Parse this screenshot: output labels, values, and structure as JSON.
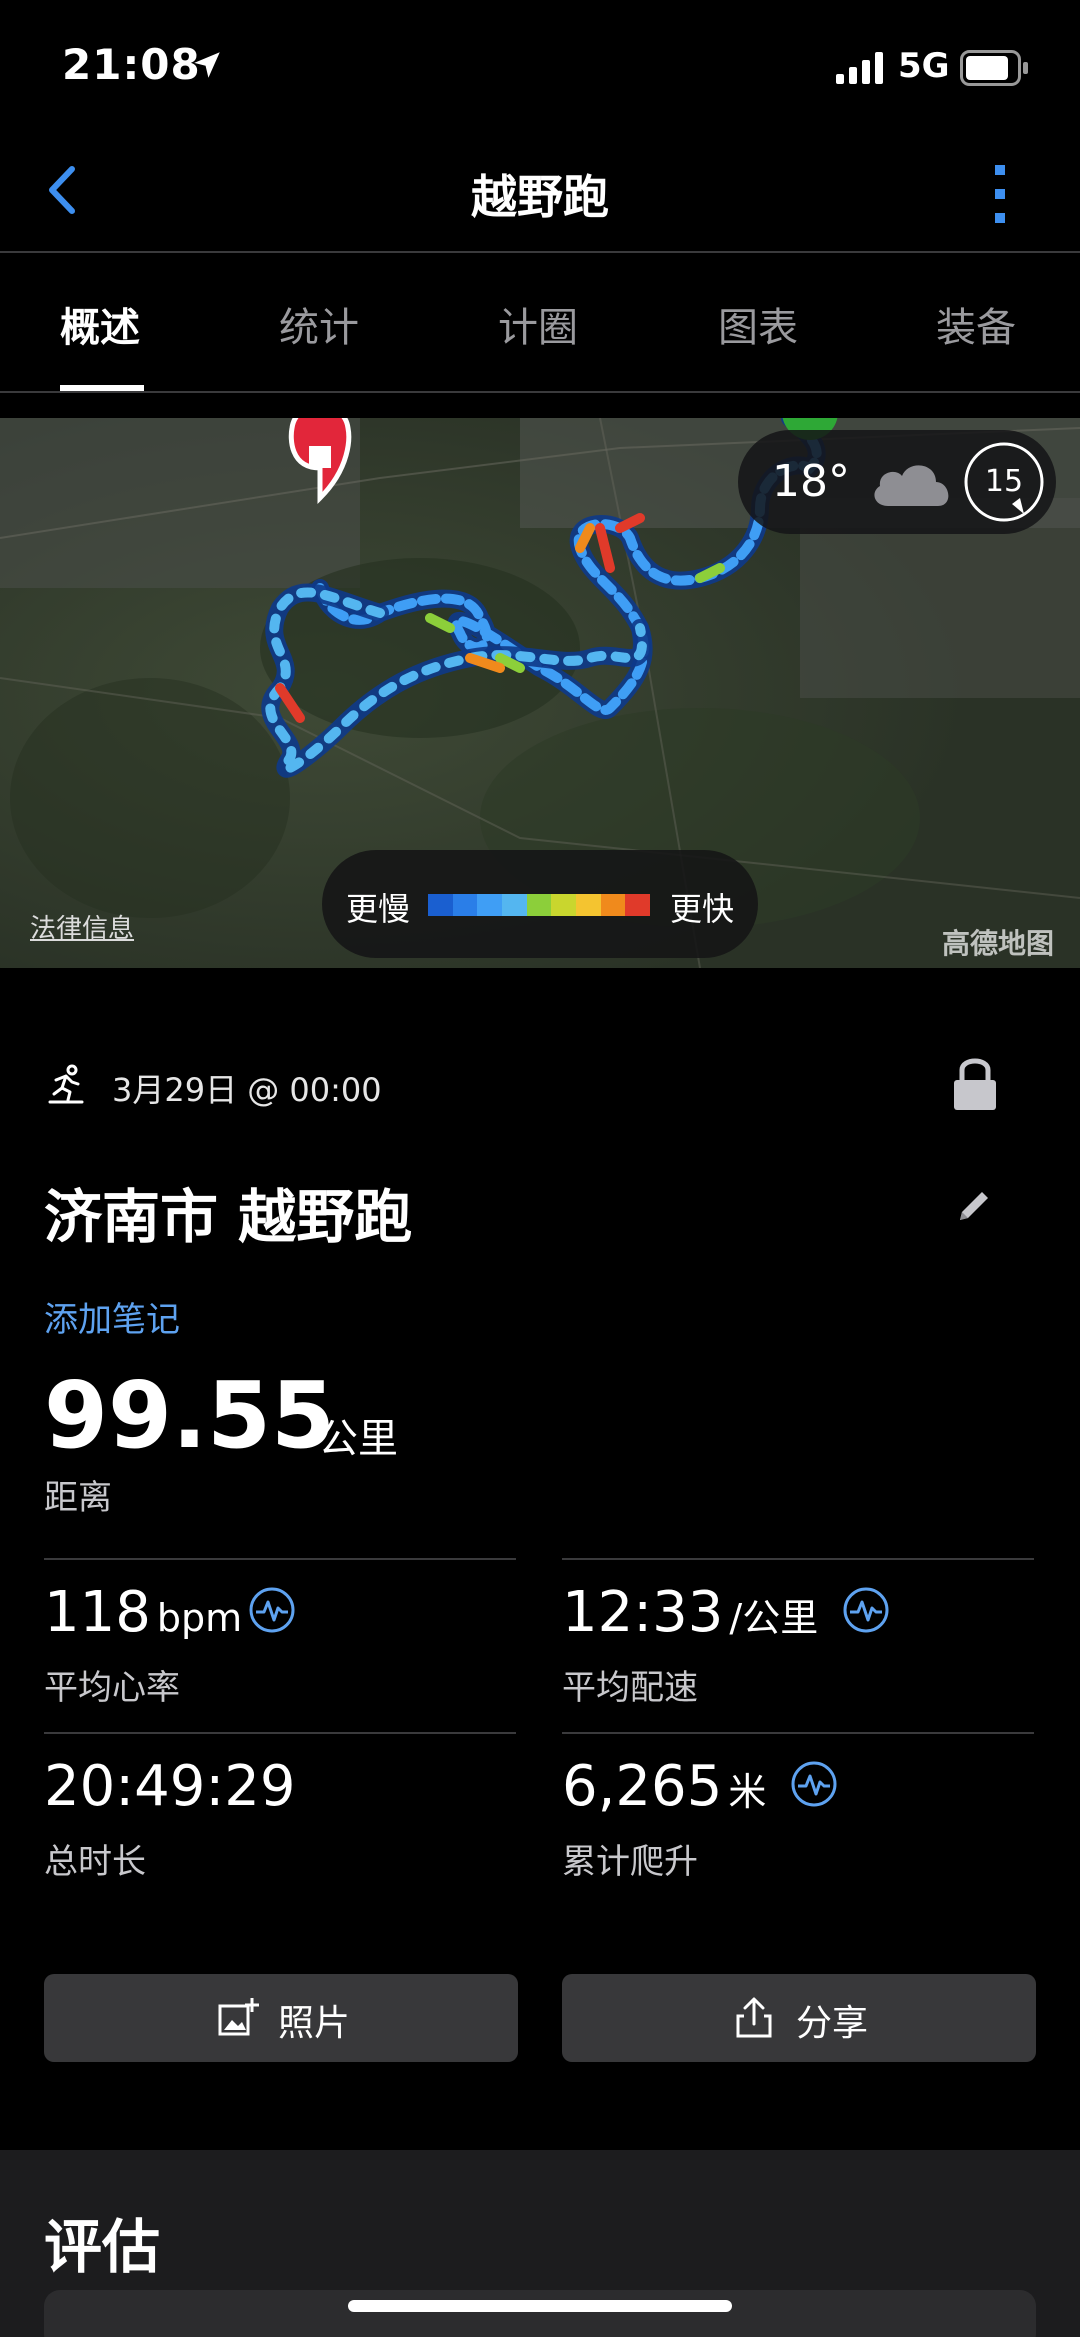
{
  "status_bar": {
    "time": "21:08",
    "network": "5G"
  },
  "header": {
    "title": "越野跑"
  },
  "tabs": [
    {
      "label": "概述",
      "active": true
    },
    {
      "label": "统计",
      "active": false
    },
    {
      "label": "计圈",
      "active": false
    },
    {
      "label": "图表",
      "active": false
    },
    {
      "label": "装备",
      "active": false
    }
  ],
  "map": {
    "weather": {
      "temperature": "18°",
      "wind": "15"
    },
    "legend": {
      "slower": "更慢",
      "faster": "更快",
      "colors": [
        "#1a5fd0",
        "#2a7ee8",
        "#3f9ef5",
        "#54b6f0",
        "#8ccf3a",
        "#c9d62e",
        "#f4c430",
        "#f08a1c",
        "#e03a2a"
      ]
    },
    "legal_link": "法律信息",
    "provider": "高德地图"
  },
  "activity": {
    "datetime": "3月29日 @ 00:00",
    "title": "济南市 越野跑",
    "add_note": "添加笔记",
    "distance": {
      "value": "99.55",
      "unit": "公里",
      "label": "距离"
    },
    "stats": {
      "heart_rate": {
        "value": "118",
        "unit": "bpm",
        "label": "平均心率"
      },
      "pace": {
        "value": "12:33",
        "unit": "/公里",
        "label": "平均配速"
      },
      "duration": {
        "value": "20:49:29",
        "label": "总时长"
      },
      "elevation": {
        "value": "6,265",
        "unit": "米",
        "label": "累计爬升"
      }
    }
  },
  "actions": {
    "photos": "照片",
    "share": "分享"
  },
  "evaluation": {
    "title": "评估"
  },
  "colors": {
    "accent_blue": "#5ea2f0",
    "button_bg": "#38383a"
  }
}
